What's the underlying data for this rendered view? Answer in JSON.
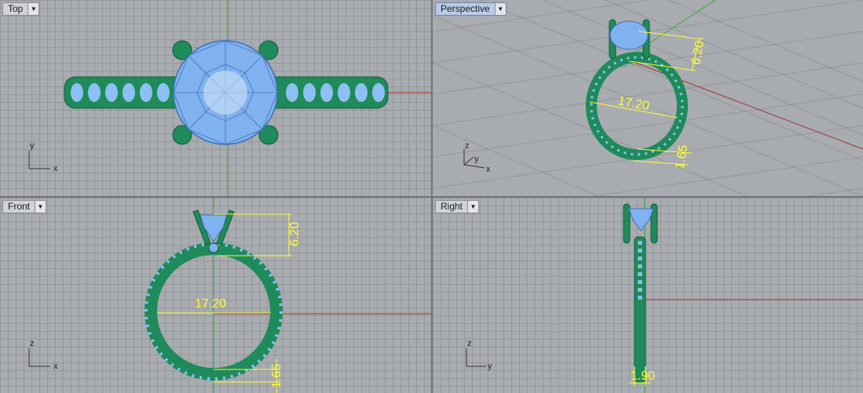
{
  "viewports": {
    "top": {
      "label": "Top",
      "axes": [
        "x",
        "y"
      ]
    },
    "perspective": {
      "label": "Perspective",
      "axes": [
        "x",
        "y",
        "z"
      ],
      "dims": [
        "6.20",
        "17.20",
        "1.65"
      ]
    },
    "front": {
      "label": "Front",
      "axes": [
        "x",
        "z"
      ],
      "dims": [
        "6.20",
        "17.20",
        "1.65"
      ]
    },
    "right": {
      "label": "Right",
      "axes": [
        "y",
        "z"
      ],
      "dims": [
        "1.90"
      ]
    }
  },
  "colors": {
    "metal": "#1f8a5a",
    "stone": "#7fb2ef",
    "dimension": "#ffff33",
    "x_axis": "#a0332a",
    "y_axis": "#2fae2f"
  },
  "icons": {
    "dropdown": "triangle-down"
  }
}
